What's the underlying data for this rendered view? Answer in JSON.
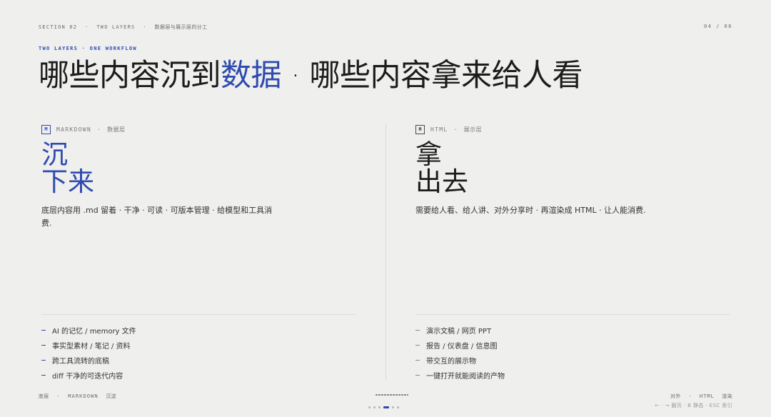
{
  "header": {
    "section": "SECTION 02",
    "sep": "·",
    "part": "TWO LAYERS",
    "subtitle": "数据层与展示层的分工",
    "page_counter": "04 / 06"
  },
  "kicker": "TWO LAYERS · ONE WORKFLOW",
  "headline": {
    "part1": "哪些内容沉到",
    "accent": "数据",
    "part2": " · 哪些内容拿来给人看"
  },
  "left_panel": {
    "badge": "M",
    "tag": "MARKDOWN",
    "dot": "·",
    "tag_cn": "数据层",
    "big_line1": "沉",
    "big_line2": "下来",
    "description": "底层内容用 .md 留着 · 干净 · 可读 · 可版本管理 · 给模型和工具消费.",
    "items": [
      "AI 的记忆 / memory 文件",
      "事实型素材 / 笔记 / 资料",
      "跨工具流转的底稿",
      "diff 干净的可迭代内容"
    ]
  },
  "right_panel": {
    "badge": "H",
    "tag": "HTML",
    "dot": "·",
    "tag_cn": "展示层",
    "big_line1": "拿",
    "big_line2": "出去",
    "description": "需要给人看、给人讲、对外分享时 · 再渲染成 HTML · 让人能消费.",
    "items": [
      "演示文稿 / 网页 PPT",
      "报告 / 仪表盘 / 信息图",
      "带交互的展示物",
      "一键打开就能阅读的产物"
    ]
  },
  "footer": {
    "left_cn": "底层",
    "left_sep": "·",
    "left_tag": "MARKDOWN",
    "left_cn2": "沉淀",
    "right_cn": "对外",
    "right_sep": "·",
    "right_tag": "HTML",
    "right_cn2": "渲染",
    "hint": "← · → 翻页 · B 静态 · ESC 索引",
    "slide_count": 6,
    "active_slide": 4
  },
  "colors": {
    "accent": "#2f4bb0",
    "background": "#efefed",
    "text": "#1c1c1c"
  }
}
